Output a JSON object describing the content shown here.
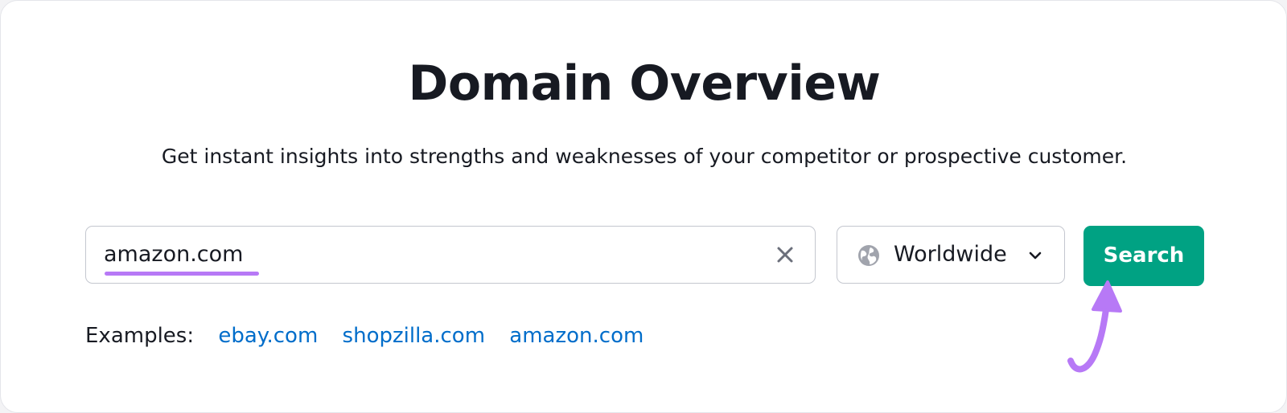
{
  "page": {
    "title": "Domain Overview",
    "subtitle": "Get instant insights into strengths and weaknesses of your competitor or prospective customer."
  },
  "search": {
    "value": "amazon.com",
    "clear_icon": "close-icon"
  },
  "region": {
    "label": "Worldwide",
    "icon": "globe-icon",
    "dropdown_icon": "chevron-down-icon"
  },
  "search_button": {
    "label": "Search"
  },
  "examples": {
    "label": "Examples:",
    "links": [
      "ebay.com",
      "shopzilla.com",
      "amazon.com"
    ]
  },
  "annotation": {
    "arrow_icon": "curved-arrow-icon",
    "highlight_color": "#b779f6"
  },
  "colors": {
    "accent": "#00a283",
    "link": "#006dca",
    "text": "#171a22"
  }
}
